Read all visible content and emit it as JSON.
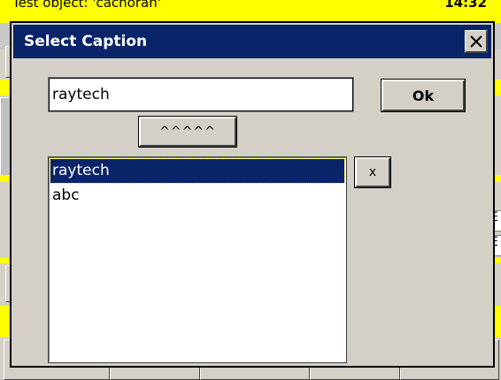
{
  "background": {
    "title": "Test object: 'cachoran'",
    "clock": "14:32",
    "letters": [
      "C",
      "t"
    ],
    "right_marks": [
      "E",
      "E"
    ],
    "accent_yellow": "#ffff00"
  },
  "dialog": {
    "title": "Select Caption",
    "close_icon": "close-icon",
    "caption_input_value": "raytech",
    "ok_label": "Ok",
    "up_label": "^^^^^",
    "delete_label": "x",
    "captions": [
      "raytech",
      "abc"
    ],
    "selected_index": 0,
    "titlebar_color": "#0a246a"
  }
}
